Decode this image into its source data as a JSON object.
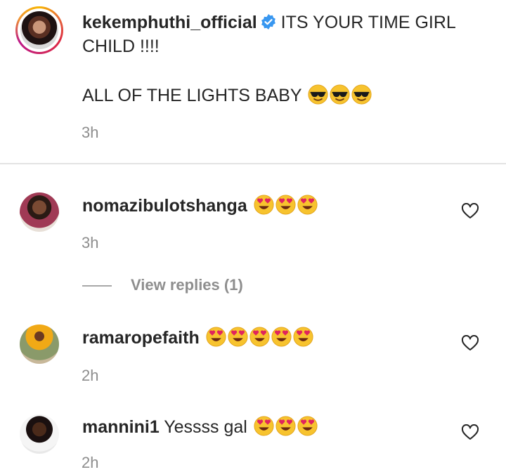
{
  "caption": {
    "username": "kekemphuthi_official",
    "text_line1": "ITS YOUR TIME GIRL",
    "text_line2": "CHILD !!!!",
    "text_line3": "ALL OF THE LIGHTS BABY",
    "emoji": "smiling-face-with-sunglasses",
    "emoji_count": 3,
    "time": "3h"
  },
  "comments": [
    {
      "username": "nomazibulotshanga",
      "text": "",
      "emoji": "heart-eyes",
      "emoji_count": 3,
      "time": "3h"
    },
    {
      "username": "ramaropefaith",
      "text": "",
      "emoji": "heart-eyes",
      "emoji_count": 5,
      "time": "2h"
    },
    {
      "username": "mannini1",
      "text": "Yessss gal",
      "emoji": "heart-eyes",
      "emoji_count": 3,
      "time": "2h"
    }
  ],
  "view_replies": "View replies (1)",
  "colors": {
    "text": "#262626",
    "secondary": "#8e8e8e",
    "verified": "#3897f0",
    "emoji": "#f7c32e"
  }
}
